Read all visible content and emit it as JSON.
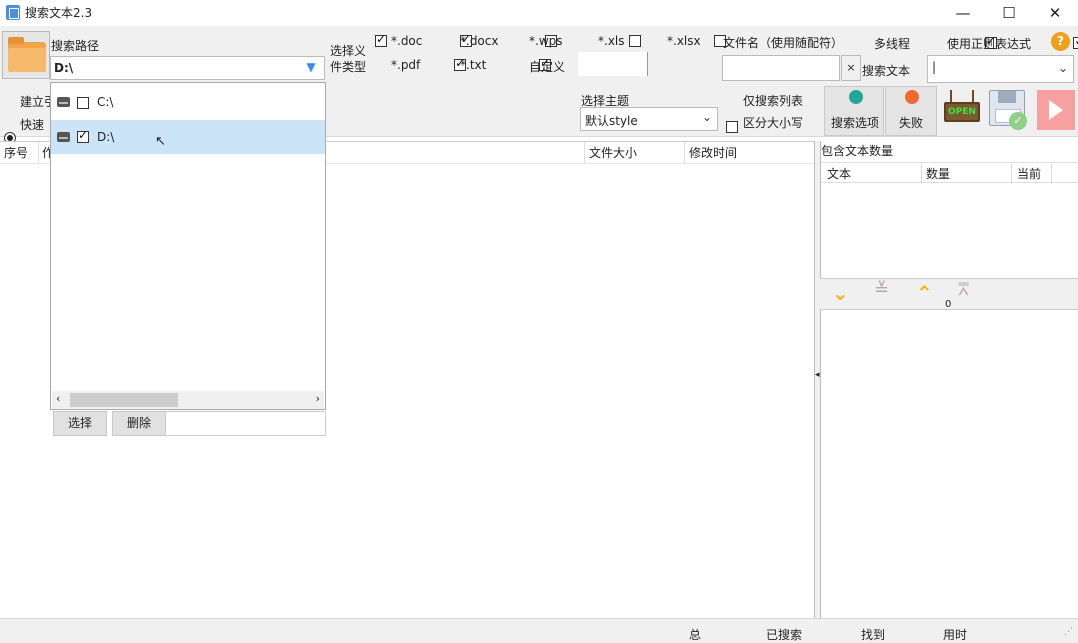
{
  "window": {
    "title": "搜索文本2.3"
  },
  "toolbar": {
    "search_path_label": "搜索路径",
    "path_value": "D:\\",
    "select_ext_label_1": "选择义",
    "select_ext_label_2": "件类型",
    "filetypes": [
      {
        "label": "*.doc",
        "checked": true
      },
      {
        "label": "*.docx",
        "checked": true
      },
      {
        "label": "*.wps",
        "checked": false
      },
      {
        "label": "*.xls",
        "checked": false
      },
      {
        "label": "*.xlsx",
        "checked": false
      },
      {
        "label": "*.pdf",
        "checked": true
      },
      {
        "label": "*.txt",
        "checked": true
      },
      {
        "label": "自定义",
        "checked": false
      }
    ],
    "filename_label": "文件名（使用随配符）",
    "multithread_label": "多线程",
    "multithread_checked": true,
    "regex_label": "使用正则表达式",
    "regex_checked": true,
    "help_icon": "?",
    "clear_icon": "×",
    "search_text_label": "搜索文本",
    "search_text_value": "|",
    "build_index_label": "建立引",
    "fast_label": "快速",
    "theme_label": "选择主题",
    "theme_value": "默认style",
    "only_index_label": "仅搜索列表",
    "only_index_checked": false,
    "case_label": "区分大小写",
    "case_checked": true,
    "search_options_label": "搜索选项",
    "fail_label": "失败",
    "open_sign": "OPEN"
  },
  "path_dropdown": {
    "items": [
      {
        "label": "C:\\",
        "checked": false
      },
      {
        "label": "D:\\",
        "checked": true
      }
    ],
    "select_btn": "选择",
    "delete_btn": "删除"
  },
  "list": {
    "columns": {
      "index": "序号",
      "col2": "作",
      "size": "文件大小",
      "mtime": "修改时间"
    }
  },
  "right_panel": {
    "title": "包含文本数量",
    "columns": {
      "text": "文本",
      "count": "数量",
      "current": "当前"
    },
    "small_label": "0"
  },
  "status": {
    "total": "总",
    "searched": "已搜索",
    "found": "找到",
    "time": "用时"
  },
  "colors": {
    "accent_blue": "#3b8de0",
    "play_red": "#f26b6b",
    "arrow_orange": "#f2b318",
    "arrow_gray": "#b8a8a0",
    "selected_row": "#cce4f7"
  }
}
